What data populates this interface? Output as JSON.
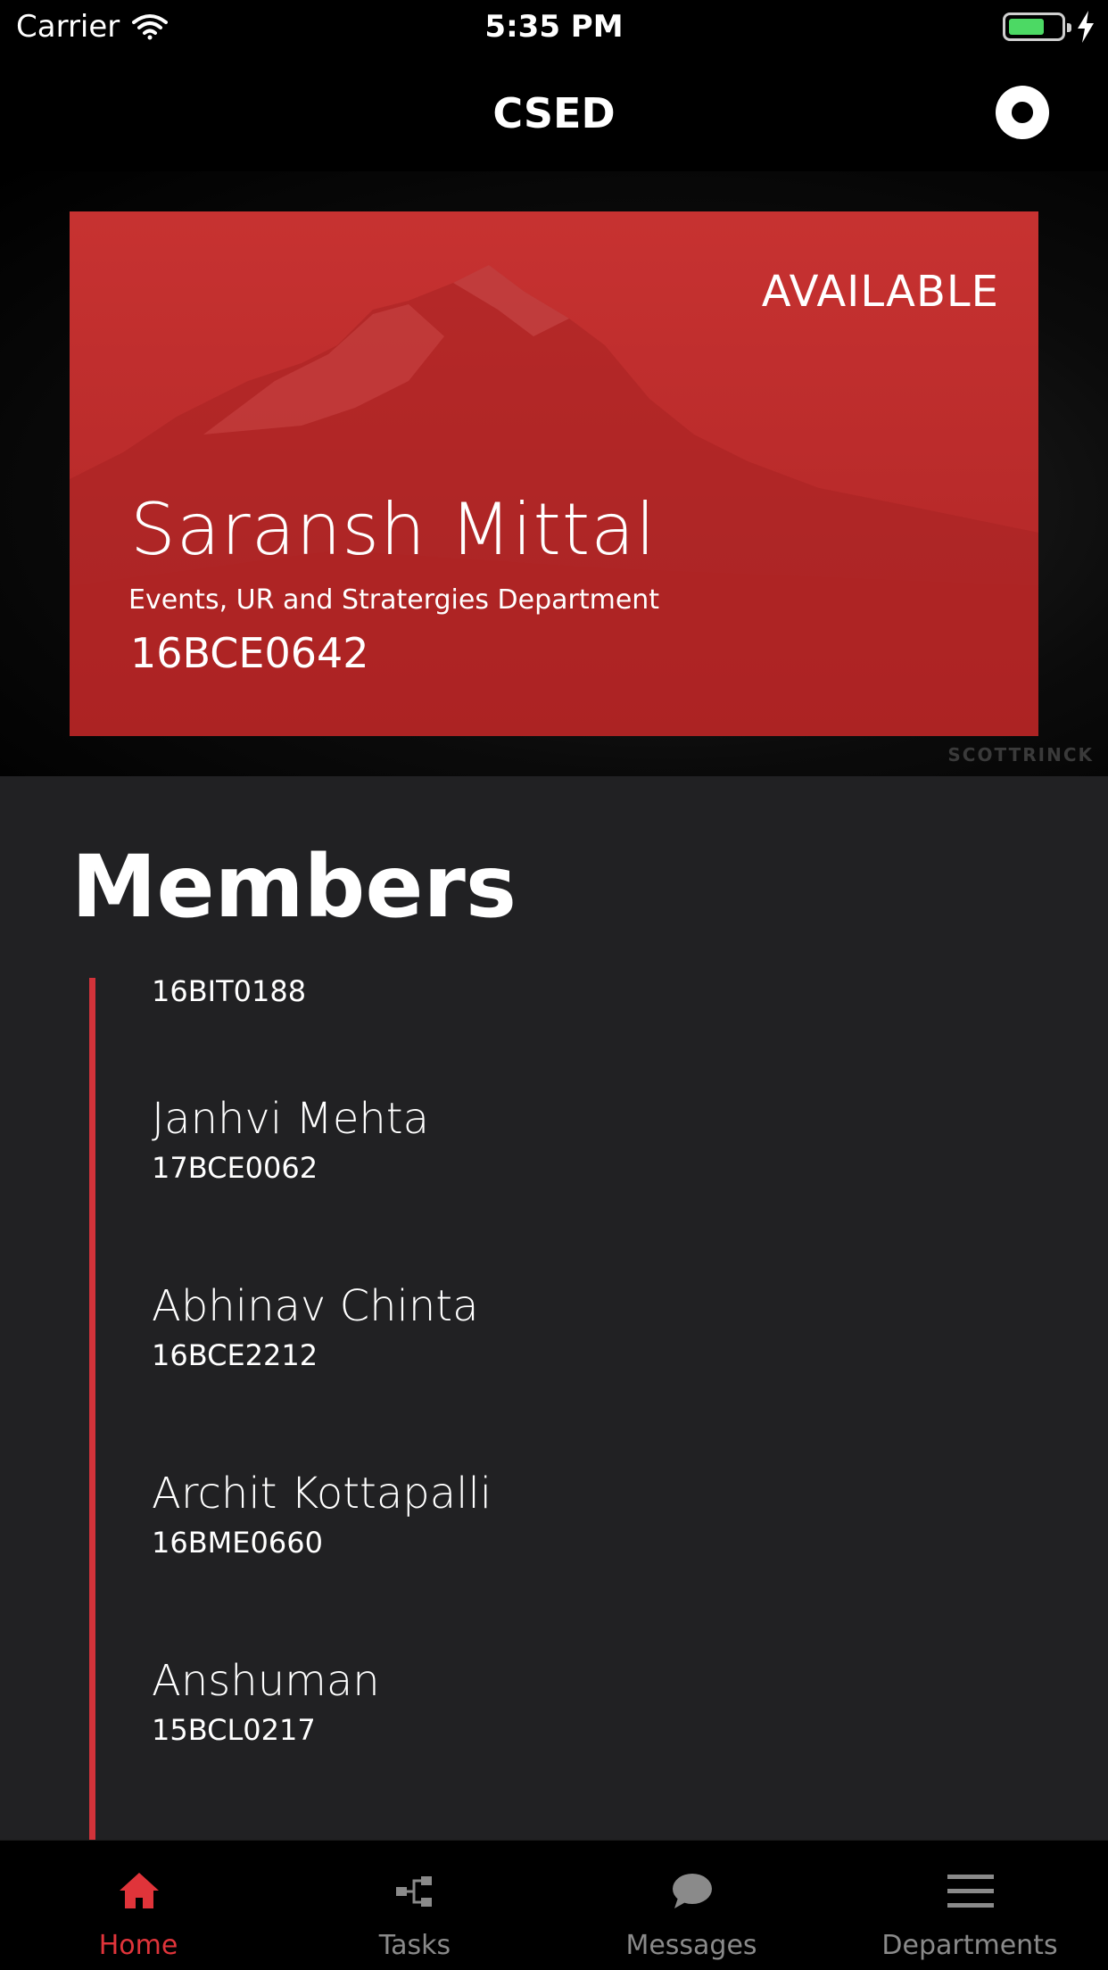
{
  "status_bar": {
    "carrier": "Carrier",
    "time": "5:35 PM",
    "battery_level": 0.7
  },
  "nav": {
    "title": "CSED"
  },
  "profile": {
    "status": "AVAILABLE",
    "name": "Saransh Mittal",
    "department": "Events, UR and Stratergies Department",
    "id": "16BCE0642",
    "watermark": "SCOTTRINCK"
  },
  "members": {
    "title": "Members",
    "items": [
      {
        "name": "",
        "id": "16BIT0188"
      },
      {
        "name": "Janhvi Mehta",
        "id": "17BCE0062"
      },
      {
        "name": "Abhinav Chinta",
        "id": "16BCE2212"
      },
      {
        "name": "Archit Kottapalli",
        "id": "16BME0660"
      },
      {
        "name": "Anshuman",
        "id": "15BCL0217"
      }
    ]
  },
  "tabs": [
    {
      "label": "Home",
      "icon": "home-icon",
      "active": true
    },
    {
      "label": "Tasks",
      "icon": "tasks-icon",
      "active": false
    },
    {
      "label": "Messages",
      "icon": "messages-icon",
      "active": false
    },
    {
      "label": "Departments",
      "icon": "departments-icon",
      "active": false
    }
  ],
  "colors": {
    "accent": "#e0343a",
    "card": "#c0302f",
    "background": "#212123"
  }
}
